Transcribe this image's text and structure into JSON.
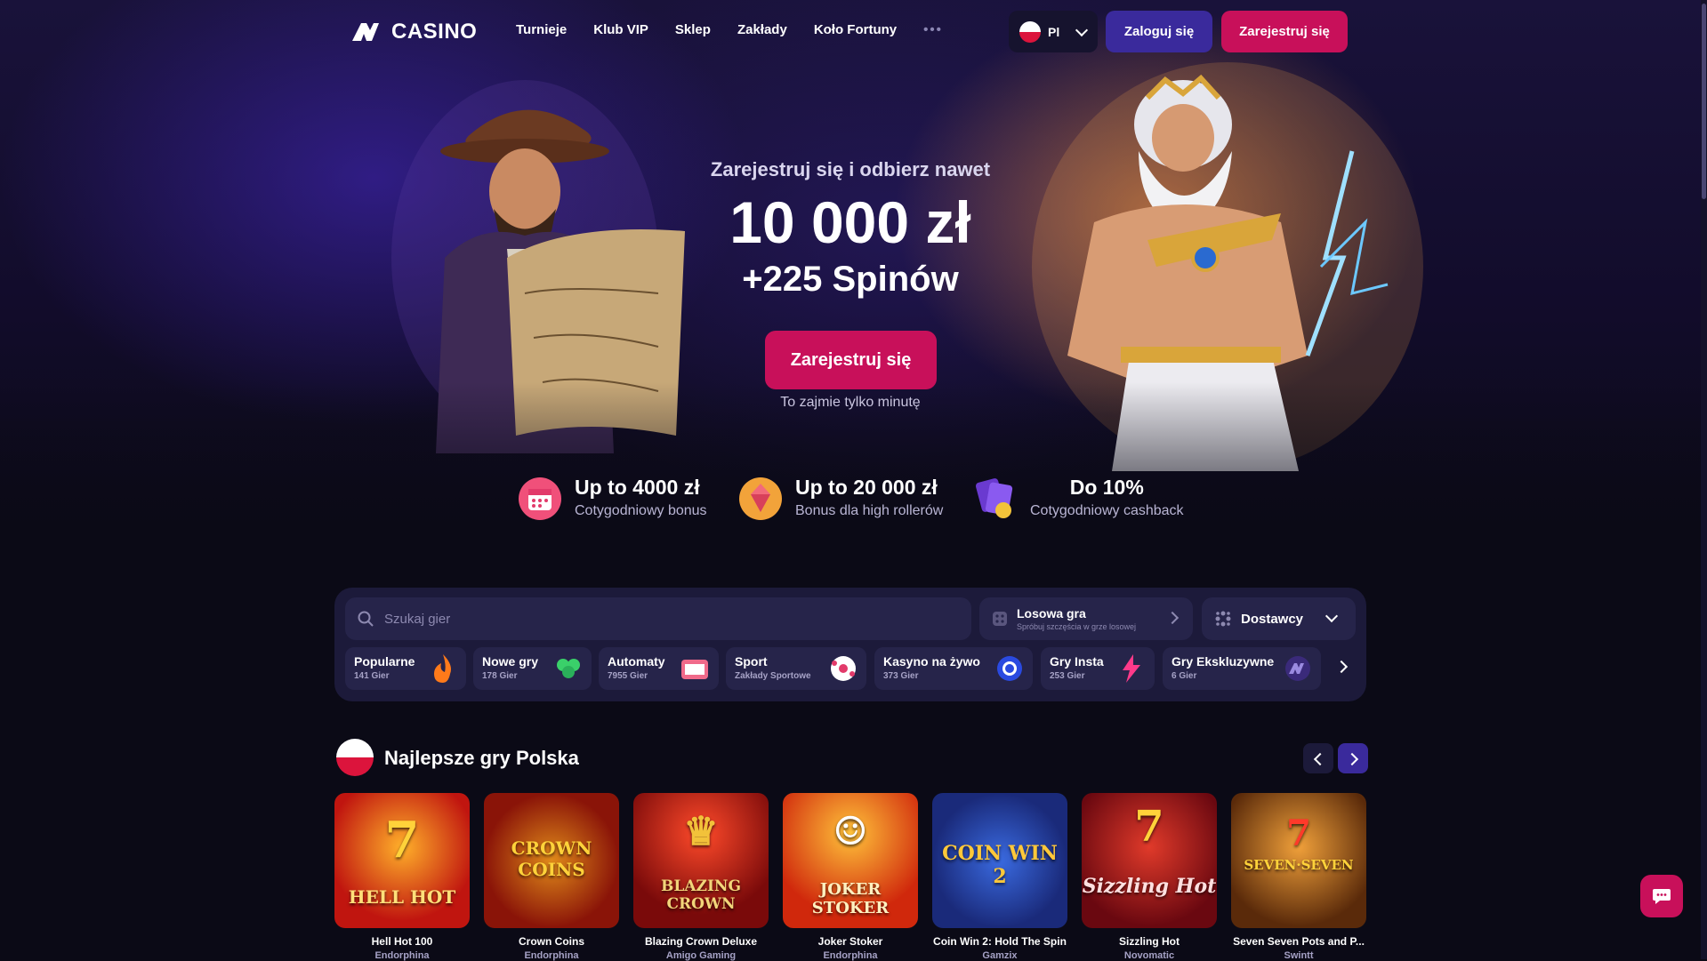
{
  "header": {
    "logo_text": "CASINO",
    "nav": [
      "Turnieje",
      "Klub VIP",
      "Sklep",
      "Zakłady",
      "Koło Fortuny"
    ],
    "more": "•••",
    "lang": "Pl",
    "login": "Zaloguj się",
    "register": "Zarejestruj się"
  },
  "hero": {
    "subtitle": "Zarejestruj się i odbierz nawet",
    "amount": "10 000 zł",
    "spins": "+225 Spinów",
    "cta": "Zarejestruj się",
    "note": "To zajmie tylko minutę"
  },
  "benefits": [
    {
      "title": "Up to 4000 zł",
      "desc": "Cotygodniowy bonus"
    },
    {
      "title": "Up to 20 000 zł",
      "desc": "Bonus dla high rollerów"
    },
    {
      "title": "Do 10%",
      "desc": "Cotygodniowy cashback"
    }
  ],
  "search": {
    "placeholder": "Szukaj gier",
    "random_title": "Losowa gra",
    "random_sub": "Spróbuj szczęścia w grze losowej",
    "providers": "Dostawcy"
  },
  "categories": [
    {
      "name": "Popularne",
      "count": "141 Gier"
    },
    {
      "name": "Nowe gry",
      "count": "178 Gier"
    },
    {
      "name": "Automaty",
      "count": "7955 Gier"
    },
    {
      "name": "Sport",
      "count": "Zakłady Sportowe"
    },
    {
      "name": "Kasyno na żywo",
      "count": "373 Gier"
    },
    {
      "name": "Gry Insta",
      "count": "253 Gier"
    },
    {
      "name": "Gry Ekskluzywne",
      "count": "6 Gier"
    }
  ],
  "top_games": {
    "title": "Najlepsze gry Polska",
    "games": [
      {
        "title": "Hell Hot 100",
        "provider": "Endorphina",
        "art": "HELL HOT",
        "color": "#c0150f"
      },
      {
        "title": "Crown Coins",
        "provider": "Endorphina",
        "art": "CROWN COINS",
        "color": "#8a1408"
      },
      {
        "title": "Blazing Crown Deluxe",
        "provider": "Amigo Gaming",
        "art": "BLAZING CROWN",
        "color": "#7a0a0a"
      },
      {
        "title": "Joker Stoker",
        "provider": "Endorphina",
        "art": "JOKER STOKER",
        "color": "#d0280c"
      },
      {
        "title": "Coin Win 2: Hold The Spin",
        "provider": "Gamzix",
        "art": "COIN WIN 2",
        "color": "#1a2a7a"
      },
      {
        "title": "Sizzling Hot",
        "provider": "Novomatic",
        "art": "Sizzling Hot",
        "color": "#b8101a"
      },
      {
        "title": "Seven Seven Pots and P...",
        "provider": "Swintt",
        "art": "SEVEN·SEVEN",
        "color": "#a0500c"
      }
    ]
  }
}
